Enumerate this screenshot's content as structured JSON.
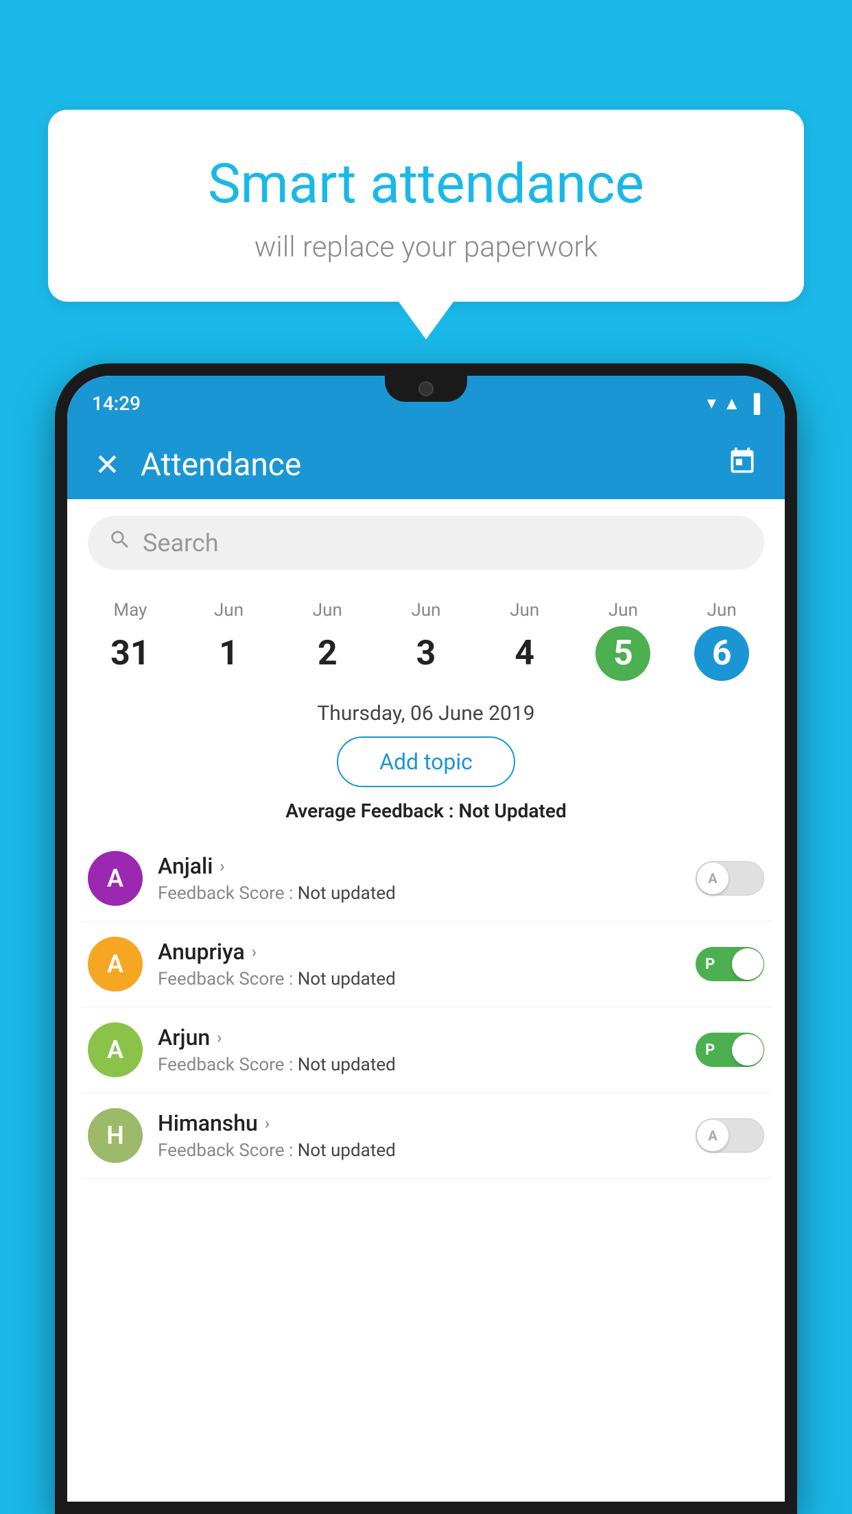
{
  "background_color": "#1ab8e8",
  "speech_bubble": {
    "title": "Smart attendance",
    "subtitle": "will replace your paperwork"
  },
  "status_bar": {
    "time": "14:29",
    "icons": [
      "▼",
      "▲",
      "▐"
    ]
  },
  "app_header": {
    "title": "Attendance",
    "close_label": "✕",
    "calendar_icon": "📅"
  },
  "search": {
    "placeholder": "Search"
  },
  "dates": [
    {
      "month": "May",
      "day": "31",
      "state": "normal"
    },
    {
      "month": "Jun",
      "day": "1",
      "state": "normal"
    },
    {
      "month": "Jun",
      "day": "2",
      "state": "normal"
    },
    {
      "month": "Jun",
      "day": "3",
      "state": "normal"
    },
    {
      "month": "Jun",
      "day": "4",
      "state": "normal"
    },
    {
      "month": "Jun",
      "day": "5",
      "state": "today"
    },
    {
      "month": "Jun",
      "day": "6",
      "state": "selected"
    }
  ],
  "selected_date_label": "Thursday, 06 June 2019",
  "add_topic_label": "Add topic",
  "avg_feedback": {
    "label": "Average Feedback : ",
    "value": "Not Updated"
  },
  "students": [
    {
      "name": "Anjali",
      "avatar_letter": "A",
      "avatar_color": "#9c27b0",
      "feedback_label": "Feedback Score : ",
      "feedback_value": "Not updated",
      "toggle_state": "off",
      "toggle_letter": "A"
    },
    {
      "name": "Anupriya",
      "avatar_letter": "A",
      "avatar_color": "#f5a623",
      "feedback_label": "Feedback Score : ",
      "feedback_value": "Not updated",
      "toggle_state": "on",
      "toggle_letter": "P"
    },
    {
      "name": "Arjun",
      "avatar_letter": "A",
      "avatar_color": "#8bc34a",
      "feedback_label": "Feedback Score : ",
      "feedback_value": "Not updated",
      "toggle_state": "on",
      "toggle_letter": "P"
    },
    {
      "name": "Himanshu",
      "avatar_letter": "H",
      "avatar_color": "#9cba6a",
      "feedback_label": "Feedback Score : ",
      "feedback_value": "Not updated",
      "toggle_state": "off",
      "toggle_letter": "A"
    }
  ]
}
